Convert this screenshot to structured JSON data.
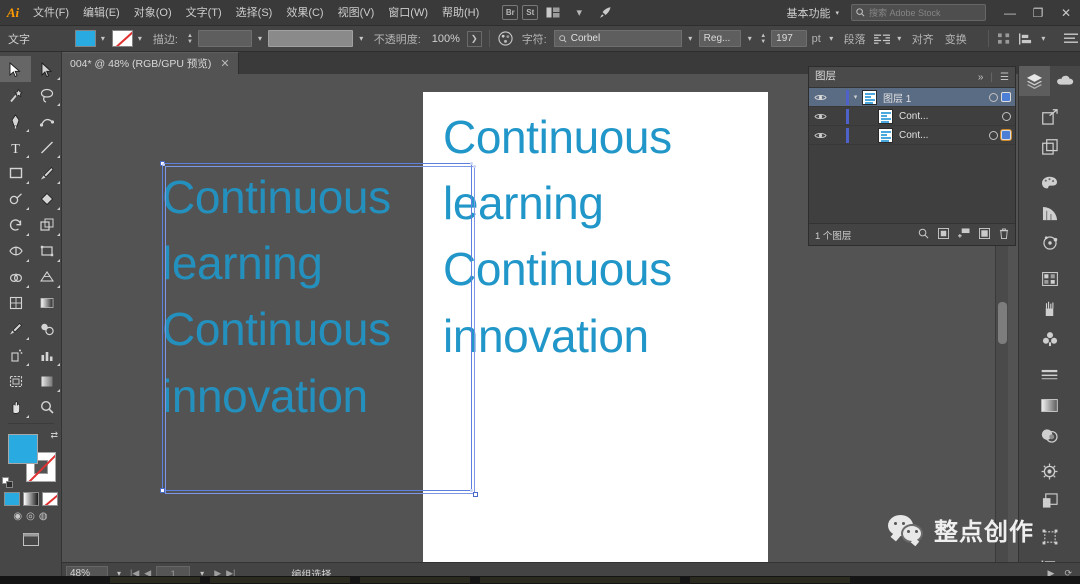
{
  "menubar": {
    "logo": "Ai",
    "items": [
      {
        "label": "文件(F)",
        "name": "file"
      },
      {
        "label": "编辑(E)",
        "name": "edit"
      },
      {
        "label": "对象(O)",
        "name": "object"
      },
      {
        "label": "文字(T)",
        "name": "type"
      },
      {
        "label": "选择(S)",
        "name": "select"
      },
      {
        "label": "效果(C)",
        "name": "effect"
      },
      {
        "label": "视图(V)",
        "name": "view"
      },
      {
        "label": "窗口(W)",
        "name": "window"
      },
      {
        "label": "帮助(H)",
        "name": "help"
      }
    ],
    "bridge_label": "Br",
    "stock_label": "St",
    "arrange_label": "",
    "workspace": "基本功能",
    "search_placeholder": "搜索 Adobe Stock",
    "window_buttons": {
      "minimize": "—",
      "restore": "❐",
      "close": "✕"
    }
  },
  "controlbar": {
    "object_type": "文字",
    "fill_label": "填色",
    "fill_color": "#29abe2",
    "stroke_label": "描边:",
    "stroke_color": "none",
    "stroke_weight": "",
    "opacity_label": "不透明度:",
    "opacity_value": "100%",
    "character_label": "字符:",
    "font_family": "Corbel",
    "font_style": "Reg...",
    "font_size": "197",
    "font_size_unit": "pt",
    "paragraph_label": "段落",
    "align_label": "对齐",
    "transform_label": "变换"
  },
  "tabbar": {
    "tab_title": "004* @ 48% (RGB/GPU 预览)",
    "close_glyph": "✕"
  },
  "toolbar": {
    "tools": [
      {
        "name": "selection-tool",
        "active": true
      },
      {
        "name": "direct-selection-tool",
        "active": false
      },
      {
        "name": "magic-wand-tool",
        "active": false
      },
      {
        "name": "lasso-tool",
        "active": false
      },
      {
        "name": "pen-tool",
        "active": false
      },
      {
        "name": "curvature-tool",
        "active": false
      },
      {
        "name": "type-tool",
        "active": false
      },
      {
        "name": "line-segment-tool",
        "active": false
      },
      {
        "name": "rectangle-tool",
        "active": false
      },
      {
        "name": "paintbrush-tool",
        "active": false
      },
      {
        "name": "shaper-tool",
        "active": false
      },
      {
        "name": "eraser-tool",
        "active": false
      },
      {
        "name": "rotate-tool",
        "active": false
      },
      {
        "name": "scale-tool",
        "active": false
      },
      {
        "name": "width-tool",
        "active": false
      },
      {
        "name": "free-transform-tool",
        "active": false
      },
      {
        "name": "shape-builder-tool",
        "active": false
      },
      {
        "name": "perspective-grid-tool",
        "active": false
      },
      {
        "name": "mesh-tool",
        "active": false
      },
      {
        "name": "gradient-tool",
        "active": false
      },
      {
        "name": "eyedropper-tool",
        "active": false
      },
      {
        "name": "blend-tool",
        "active": false
      },
      {
        "name": "symbol-sprayer-tool",
        "active": false
      },
      {
        "name": "column-graph-tool",
        "active": false
      },
      {
        "name": "artboard-tool",
        "active": false
      },
      {
        "name": "slice-tool",
        "active": false
      },
      {
        "name": "hand-tool",
        "active": false
      },
      {
        "name": "zoom-tool",
        "active": false
      }
    ],
    "fill_color": "#29abe2",
    "stroke_color": "none"
  },
  "canvas": {
    "artboard_text": "Continuous\nlearning\nContinuous\ninnovation",
    "selected_text": "Continuous\nlearning\nContinuous\ninnovation",
    "text_color": "#2196c8",
    "selection_border_color": "#5c7fe0"
  },
  "layers_panel": {
    "title": "图层",
    "collapse_glyph": "»",
    "menu_glyph": "☰",
    "rows": [
      {
        "name": "图层 1",
        "selected": true,
        "visible": true,
        "locked": false,
        "has_target_fill": true
      },
      {
        "name": "Cont...",
        "selected": false,
        "visible": true,
        "locked": false,
        "has_target_fill": false
      },
      {
        "name": "Cont...",
        "selected": false,
        "visible": true,
        "locked": false,
        "has_target_fill": true
      }
    ],
    "footer_count": "1 个图层",
    "footer_icons": [
      "locate-object-icon",
      "make-clipping-mask-icon",
      "create-new-sublayer-icon",
      "create-new-layer-icon",
      "delete-selection-icon"
    ]
  },
  "dock": {
    "items": [
      {
        "name": "layers-panel-icon",
        "active": true
      },
      {
        "name": "libraries-panel-icon",
        "active": false
      },
      {
        "name": "export-panel-icon",
        "active": false
      },
      {
        "name": "artboards-panel-icon",
        "active": false
      },
      {
        "name": "color-panel-icon",
        "active": false
      },
      {
        "name": "color-guide-panel-icon",
        "active": false
      },
      {
        "name": "color-themes-panel-icon",
        "active": false
      },
      {
        "name": "swatches-panel-icon",
        "active": false
      },
      {
        "name": "brushes-panel-icon",
        "active": false
      },
      {
        "name": "symbols-panel-icon",
        "active": false
      },
      {
        "name": "stroke-panel-icon",
        "active": false
      },
      {
        "name": "gradient-panel-icon",
        "active": false
      },
      {
        "name": "transparency-panel-icon",
        "active": false
      },
      {
        "name": "appearance-panel-icon",
        "active": false
      },
      {
        "name": "graphic-styles-panel-icon",
        "active": false
      },
      {
        "name": "transform-panel-icon",
        "active": false
      },
      {
        "name": "align-panel-icon",
        "active": false
      }
    ]
  },
  "statusbar": {
    "zoom": "48%",
    "page_number": "1",
    "status_text": "编组选择",
    "nav_first": "|◀",
    "nav_prev": "◀",
    "nav_next": "▶",
    "nav_last": "▶|"
  },
  "watermark": {
    "text": "整点创作"
  }
}
